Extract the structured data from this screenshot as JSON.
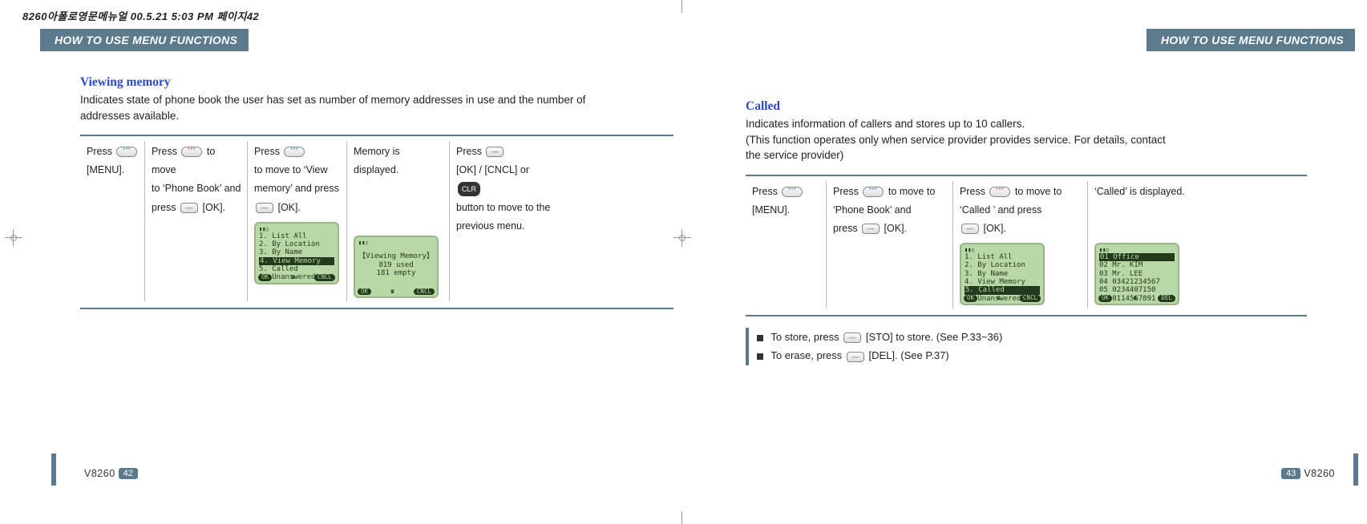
{
  "meta_header": "8260아폴로영문메뉴얼  00.5.21 5:03 PM  페이지42",
  "tab_label": "HOW TO USE MENU FUNCTIONS",
  "model": "V8260",
  "left_page": {
    "page_number": "42",
    "section_title": "Viewing memory",
    "section_desc": "Indicates state of phone book the user  has set as number of memory addresses  in use and the number of addresses available.",
    "steps": {
      "c1a": "Press ",
      "c1b": "[MENU].",
      "c2a": "Press ",
      "c2b": " to move",
      "c2c": "to ‘Phone Book’ and",
      "c2d": "press ",
      "c2e": " [OK].",
      "c3a": "Press ",
      "c3b": " to move to ‘View",
      "c3c": "memory’ and press",
      "c3d": "[OK].",
      "c4a": "Memory is displayed.",
      "c5a": "Press ",
      "c5b": "[OK] / [CNCL] or ",
      "c5c": "button to move to the",
      "c5d": "previous menu.",
      "clr_label": "CLR"
    },
    "lcd1": {
      "l1": "1. List All",
      "l2": "2. By Location",
      "l3": "3. By Name",
      "l4": "4. View Memory",
      "l5": "5. Called",
      "l6": "6. Unanswered",
      "ok": "OK",
      "phone": "☎",
      "cncl": "CNCL"
    },
    "lcd2": {
      "title": "【Viewing Memory】",
      "r1": "819 used",
      "r2": "181 empty",
      "ok": "OK",
      "phone": "☎",
      "cncl": "CNCL"
    }
  },
  "right_page": {
    "page_number": "43",
    "section_title": "Called",
    "section_desc_l1": "Indicates information of callers and stores up to 10 callers.",
    "section_desc_l2": "(This function operates only when service provider provides service. For details, contact",
    "section_desc_l3": "the service provider)",
    "steps": {
      "c1a": "Press ",
      "c1b": "[MENU].",
      "c2a": "Press ",
      "c2b": " to move to",
      "c2c": "‘Phone Book’ and",
      "c2d": "press ",
      "c2e": " [OK].",
      "c3a": "Press ",
      "c3b": " to move to",
      "c3c": "‘Called ’ and press",
      "c3d": " [OK].",
      "c4a": "‘Called’ is displayed."
    },
    "lcd1": {
      "l1": "1. List All",
      "l2": "2. By Location",
      "l3": "3. By Name",
      "l4": "4. View Memory",
      "l5": "5. Called",
      "l6": "6. Unanswered",
      "ok": "OK",
      "phone": "☎",
      "cncl": "CNCL"
    },
    "lcd2": {
      "l1": "01 Office",
      "l2": "02 Mr. KIM",
      "l3": "03 Mr. LEE",
      "l4": "04 03421234567",
      "l5": "05 0234407150",
      "l6": "06 0114567891",
      "ok": "OK",
      "phone": "☎",
      "del": "DEL"
    },
    "notes": {
      "n1a": "To store, press ",
      "n1b": " [STO] to store. (See P.33~36)",
      "n2a": "To erase, press ",
      "n2b": " [DEL]. (See P.37)"
    }
  }
}
